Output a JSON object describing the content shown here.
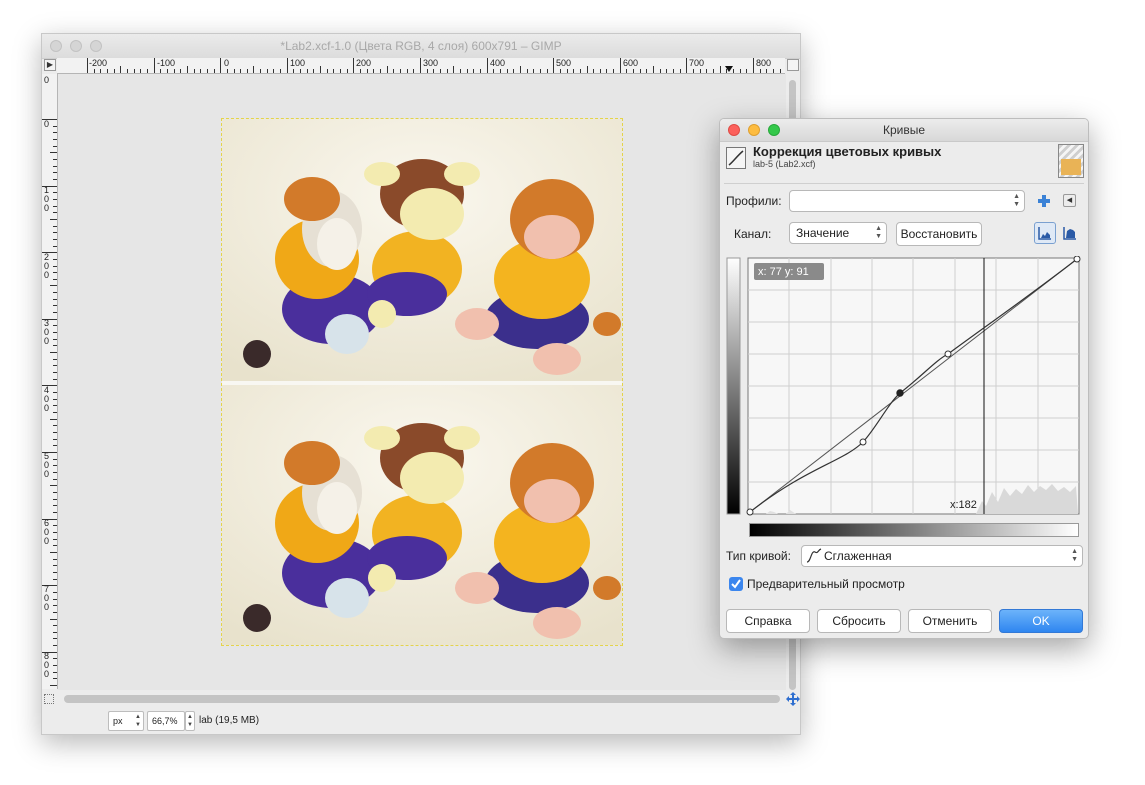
{
  "gimp": {
    "title": "*Lab2.xcf-1.0 (Цвета RGB, 4 слоя) 600x791 – GIMP",
    "hruler_labels": [
      "-200",
      "-100",
      "0",
      "100",
      "200",
      "300",
      "400",
      "500",
      "600",
      "700",
      "800"
    ],
    "vruler_labels": [
      "0",
      "0",
      "1\n0\n0",
      "2\n0\n0",
      "3\n0\n0",
      "4\n0\n0",
      "5\n0\n0",
      "6\n0\n0",
      "7\n0\n0",
      "8\n0\n0"
    ],
    "status": {
      "unit": "px",
      "zoom": "66,7%",
      "info": "lab (19,5 MB)"
    }
  },
  "curves": {
    "window_title": "Кривые",
    "heading": "Коррекция цветовых кривых",
    "subheading": "lab-5 (Lab2.xcf)",
    "profiles_label": "Профили:",
    "profiles_value": "",
    "channel_label": "Канал:",
    "channel_value": "Значение",
    "restore_button": "Восстановить",
    "pointer_readout": "x: 77 y: 91",
    "cursor_readout": "x:182",
    "curve_type_label": "Тип кривой:",
    "curve_type_value": "Сглаженная",
    "preview_label": "Предварительный просмотр",
    "preview_checked": true,
    "buttons": {
      "help": "Справка",
      "reset": "Сбросить",
      "cancel": "Отменить",
      "ok": "OK"
    },
    "colors": {
      "accent": "#2f86f0",
      "close": "#fc605b",
      "minimize": "#fdbc40",
      "maximize": "#34c84a"
    }
  }
}
